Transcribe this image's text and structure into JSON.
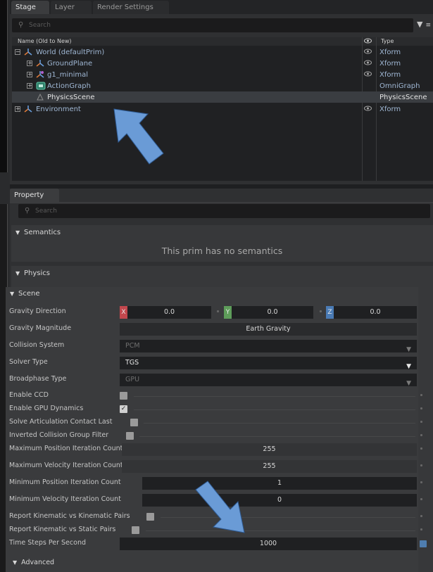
{
  "stage": {
    "tabs": [
      "Stage",
      "Layer",
      "Render Settings"
    ],
    "search_placeholder": "Search",
    "col_name": "Name (Old to New)",
    "col_type": "Type",
    "rows": [
      {
        "name": "World (defaultPrim)",
        "type": "Xform",
        "expander": "−",
        "icon": "xform-icon",
        "eye": true
      },
      {
        "name": "GroundPlane",
        "type": "Xform",
        "expander": "+",
        "icon": "xform-icon",
        "eye": true
      },
      {
        "name": "g1_minimal",
        "type": "Xform",
        "expander": "+",
        "icon": "xform-icon",
        "eye": true
      },
      {
        "name": "ActionGraph",
        "type": "OmniGraph",
        "expander": "+",
        "icon": "omnigraph-icon",
        "eye": false
      },
      {
        "name": "PhysicsScene",
        "type": "PhysicsScene",
        "expander": "",
        "icon": "physics-scene-icon",
        "eye": false,
        "selected": true
      },
      {
        "name": "Environment",
        "type": "Xform",
        "expander": "+",
        "icon": "xform-icon",
        "eye": true
      }
    ]
  },
  "property": {
    "tab": "Property",
    "search_placeholder": "Search",
    "semantics": {
      "title": "Semantics",
      "message": "This prim has no semantics"
    },
    "physics": {
      "title": "Physics",
      "scene_title": "Scene",
      "gravity_direction": {
        "label": "Gravity Direction",
        "x_axis": "X",
        "x": "0.0",
        "y_axis": "Y",
        "y": "0.0",
        "z_axis": "Z",
        "z": "0.0"
      },
      "gravity_magnitude": {
        "label": "Gravity Magnitude",
        "value": "Earth Gravity"
      },
      "collision_system": {
        "label": "Collision System",
        "value": "PCM"
      },
      "solver_type": {
        "label": "Solver Type",
        "value": "TGS"
      },
      "broadphase_type": {
        "label": "Broadphase Type",
        "value": "GPU"
      },
      "enable_ccd": {
        "label": "Enable CCD",
        "checked": false
      },
      "enable_gpu_dynamics": {
        "label": "Enable GPU Dynamics",
        "checked": true,
        "mark": "✓"
      },
      "solve_articulation": {
        "label": "Solve Articulation Contact Last",
        "checked": false
      },
      "inverted_collision": {
        "label": "Inverted Collision Group Filter",
        "checked": false
      },
      "max_position_iter": {
        "label": "Maximum Position Iteration Count",
        "value": "255"
      },
      "max_velocity_iter": {
        "label": "Maximum Velocity Iteration Count",
        "value": "255"
      },
      "min_position_iter": {
        "label": "Minimum Position Iteration Count",
        "value": "1"
      },
      "min_velocity_iter": {
        "label": "Minimum Velocity Iteration Count",
        "value": "0"
      },
      "report_kin_kin": {
        "label": "Report Kinematic vs Kinematic Pairs",
        "checked": false
      },
      "report_kin_static": {
        "label": "Report Kinematic vs Static Pairs",
        "checked": false
      },
      "time_steps": {
        "label": "Time Steps Per Second",
        "value": "1000"
      },
      "advanced": "Advanced"
    }
  },
  "colors": {
    "axis_x": "#c2474d",
    "axis_y": "#5e9d5a",
    "axis_z": "#4a7bb5",
    "arrow": "#6a9bd6"
  }
}
